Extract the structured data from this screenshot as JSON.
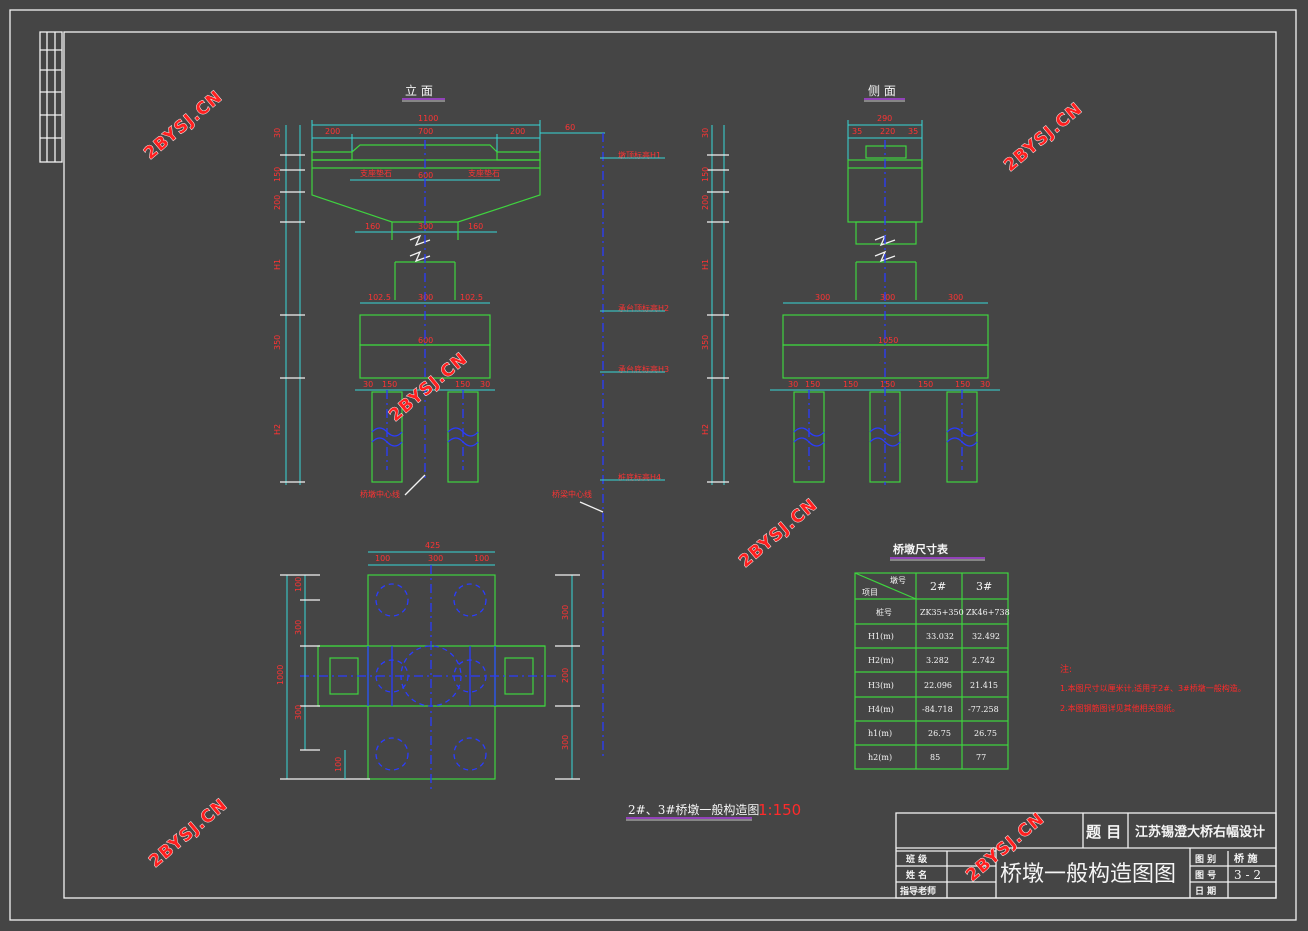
{
  "views": {
    "elevation_title": "立 面",
    "side_title": "侧 面"
  },
  "table": {
    "title": "桥墩尺寸表",
    "header_col1_top": "墩号",
    "header_col1_bottom": "项目",
    "pier_cols": [
      "2#",
      "3#"
    ],
    "rows": [
      {
        "label": "桩号",
        "p2": "ZK35+350",
        "p3": "ZK46+738"
      },
      {
        "label": "H1(m)",
        "p2": "33.032",
        "p3": "32.492"
      },
      {
        "label": "H2(m)",
        "p2": "3.282",
        "p3": "2.742"
      },
      {
        "label": "H3(m)",
        "p2": "22.096",
        "p3": "21.415"
      },
      {
        "label": "H4(m)",
        "p2": "-84.718",
        "p3": "-77.258"
      },
      {
        "label": "h1(m)",
        "p2": "26.75",
        "p3": "26.75"
      },
      {
        "label": "h2(m)",
        "p2": "85",
        "p3": "77"
      }
    ]
  },
  "notes": {
    "title": "注:",
    "line1": "1.本图尺寸以厘米计,适用于2#、3#桥墩一般构造。",
    "line2": "2.本图钢筋图详见其他相关图纸。"
  },
  "drawing_caption": {
    "text": "2#、3#桥墩一般构造图",
    "scale": "1:150"
  },
  "title_block": {
    "label_topic": "题 目",
    "project": "江苏锡澄大桥右幅设计",
    "label_class": "班 级",
    "label_name": "姓 名",
    "label_advisor": "指导老师",
    "drawing_name": "桥墩一般构造图图",
    "label_category": "图 别",
    "category": "桥 施",
    "label_number": "图 号",
    "number": "3 - 2",
    "label_date": "日 期"
  },
  "watermark": "2BYSJ.CN",
  "colors": {
    "background": "#454545",
    "frame": "#f2f2f2",
    "outline": "#3fd43f",
    "dimension": "#38d6d6",
    "centerline": "#2a3cff",
    "annotation": "#ff2a2a"
  }
}
